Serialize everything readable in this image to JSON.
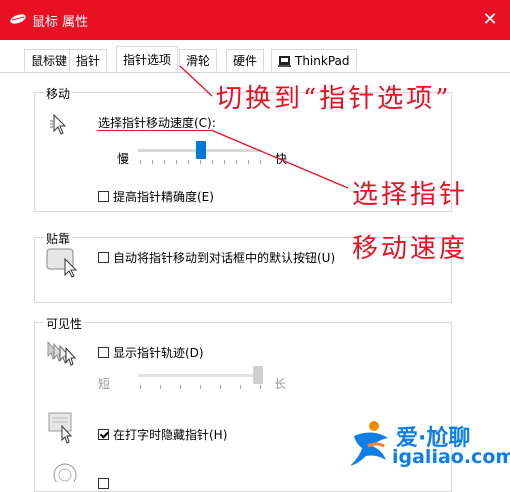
{
  "window": {
    "title": "鼠标 属性",
    "title_icon": "mouse-icon",
    "close_icon": "close-icon",
    "accent": "#e81123"
  },
  "tabs": [
    {
      "label": "鼠标键"
    },
    {
      "label": "指针"
    },
    {
      "label": "指针选项",
      "active": true
    },
    {
      "label": "滑轮"
    },
    {
      "label": "硬件"
    },
    {
      "label": "ThinkPad",
      "icon": "thinkpad-icon"
    }
  ],
  "motion": {
    "title": "移动",
    "speed_label": "选择指针移动速度(C):",
    "slow": "慢",
    "fast": "快",
    "speed_value": 0.5,
    "precision_label": "提高指针精确度(E)",
    "precision_checked": false
  },
  "snap": {
    "title": "贴靠",
    "label": "自动将指针移动到对话框中的默认按钮(U)",
    "checked": false
  },
  "visibility": {
    "title": "可见性",
    "trails_label": "显示指针轨迹(D)",
    "trails_checked": false,
    "short": "短",
    "long": "长",
    "trails_value": 1.0,
    "hide_label": "在打字时隐藏指针(H)",
    "hide_checked": true
  },
  "annotations": {
    "line1": "切换到“指针选项”",
    "line2": "选择指针",
    "line3": "移动速度"
  },
  "watermark": {
    "name": "爱·尬聊",
    "url": "igaliao.com"
  }
}
